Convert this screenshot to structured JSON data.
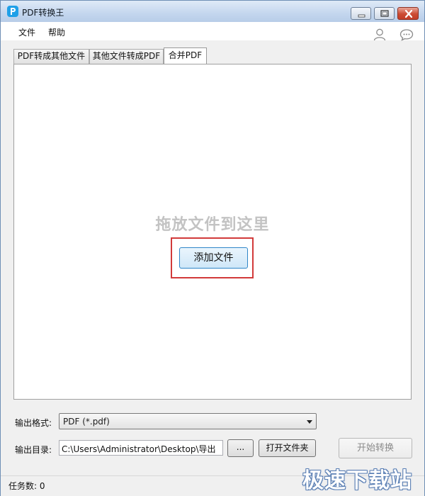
{
  "window": {
    "title": "PDF转换王",
    "app_icon": "pdf-app-icon"
  },
  "window_controls": {
    "minimize": "minimize-icon",
    "maximize": "maximize-icon",
    "close": "close-icon"
  },
  "menu": {
    "file": "文件",
    "help": "帮助"
  },
  "top_icons": {
    "user": "user-icon",
    "feedback": "chat-bubble-icon"
  },
  "tabs": [
    {
      "label": "PDF转成其他文件",
      "active": false
    },
    {
      "label": "其他文件转成PDF",
      "active": false
    },
    {
      "label": "合并PDF",
      "active": true
    }
  ],
  "dropzone": {
    "hint": "拖放文件到这里",
    "add_button": "添加文件",
    "highlight_color": "#d23a3a"
  },
  "output": {
    "format_label": "输出格式:",
    "format_value": "PDF (*.pdf)",
    "dir_label": "输出目录:",
    "dir_value": "C:\\Users\\Administrator\\Desktop\\导出",
    "browse_button": "...",
    "open_folder_button": "打开文件夹",
    "start_button": "开始转换"
  },
  "status": {
    "task_count": "任务数: 0"
  },
  "watermark": "极速下载站"
}
